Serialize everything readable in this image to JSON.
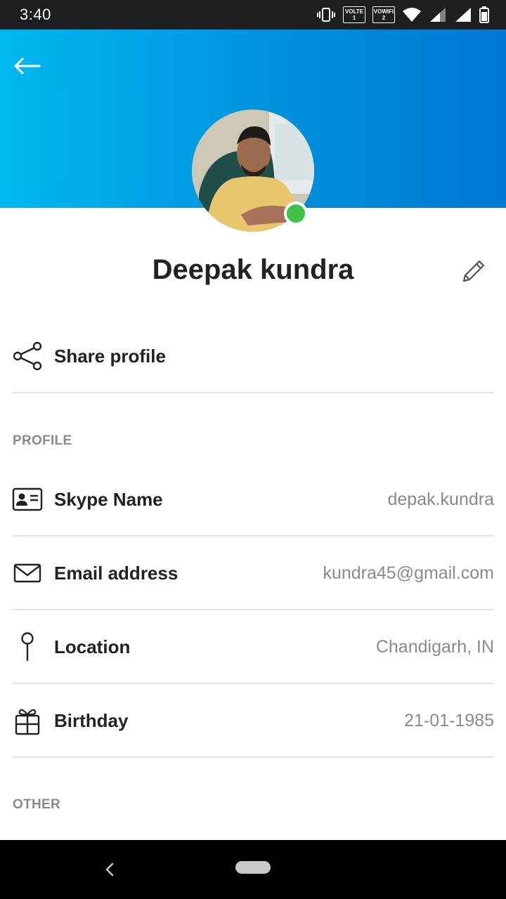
{
  "status_bar": {
    "time": "3:40",
    "icons": [
      "vibrate-icon",
      "volte-icon",
      "vowifi-icon",
      "wifi-icon",
      "signal-icon",
      "signal-icon",
      "battery-icon"
    ],
    "volte": {
      "top": "VOLTE",
      "bottom": "1"
    },
    "vowifi": {
      "top": "VOWIFI",
      "bottom": "2"
    }
  },
  "header": {
    "back_icon": "arrow-left-icon",
    "gradient_from": "#00b8ef",
    "gradient_to": "#0078d0",
    "presence_color": "#3ec24a"
  },
  "profile": {
    "name": "Deepak kundra",
    "edit_icon": "pencil-icon"
  },
  "share": {
    "label": "Share profile",
    "icon": "share-icon"
  },
  "sections": {
    "profile_heading": "PROFILE",
    "other_heading": "OTHER"
  },
  "fields": [
    {
      "label": "Skype Name",
      "value": "depak.kundra",
      "icon": "contact-card-icon"
    },
    {
      "label": "Email address",
      "value": "kundra45@gmail.com",
      "icon": "mail-icon"
    },
    {
      "label": "Location",
      "value": "Chandigarh, IN",
      "icon": "location-pin-icon"
    },
    {
      "label": "Birthday",
      "value": "21-01-1985",
      "icon": "gift-icon"
    }
  ],
  "nav": {
    "back_icon": "chevron-left-icon",
    "home_icon": "home-pill-icon"
  }
}
